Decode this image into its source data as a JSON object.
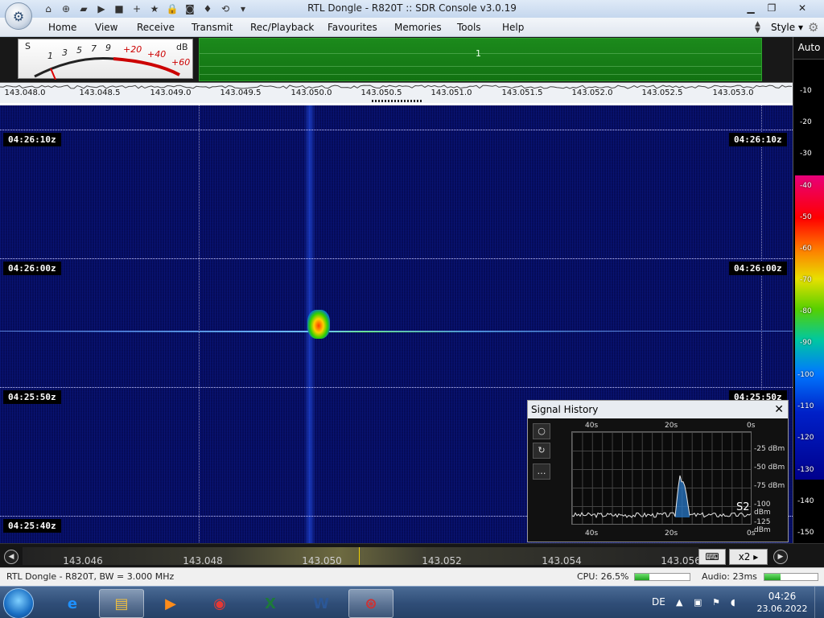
{
  "window": {
    "title": "RTL Dongle - R820T :: SDR Console v3.0.19",
    "min_icon": "minimize-icon",
    "max_icon": "maximize-icon",
    "close_icon": "close-icon"
  },
  "quick_access": [
    {
      "name": "home-icon",
      "glyph": "⌂"
    },
    {
      "name": "lifebuoy-icon",
      "glyph": "⊕"
    },
    {
      "name": "folder-icon",
      "glyph": "▰"
    },
    {
      "name": "play-icon",
      "glyph": "▶"
    },
    {
      "name": "stop-icon",
      "glyph": "■"
    },
    {
      "name": "plus-icon",
      "glyph": "+"
    },
    {
      "name": "star-icon",
      "glyph": "★"
    },
    {
      "name": "lock-icon",
      "glyph": "🔒"
    },
    {
      "name": "camera-icon",
      "glyph": "◙"
    },
    {
      "name": "drop-icon",
      "glyph": "♦"
    },
    {
      "name": "refresh-icon",
      "glyph": "⟲"
    },
    {
      "name": "dropdown-icon",
      "glyph": "▾"
    }
  ],
  "menu": {
    "items": [
      "Home",
      "View",
      "Receive",
      "Transmit",
      "Rec/Playback",
      "Favourites",
      "Memories",
      "Tools",
      "Help"
    ],
    "style_label": "Style"
  },
  "smeter": {
    "s_label": "S",
    "db_label": "dB",
    "scale": [
      "1",
      "3",
      "5",
      "7",
      "9"
    ],
    "over_scale": [
      "+20",
      "+40",
      "+60"
    ]
  },
  "band": {
    "label": "1"
  },
  "freq_scale": {
    "ticks": [
      "143.048.0",
      "143.048.5",
      "143.049.0",
      "143.049.5",
      "143.050.0",
      "143.050.5",
      "143.051.0",
      "143.051.5",
      "143.052.0",
      "143.052.5",
      "143.053.0"
    ]
  },
  "db_column": {
    "auto_label": "Auto",
    "labels": [
      "-10",
      "-20",
      "-30",
      "-40",
      "-50",
      "-60",
      "-70",
      "-80",
      "-90",
      "-100",
      "-110",
      "-120",
      "-130",
      "-140",
      "-150"
    ]
  },
  "waterfall": {
    "times": [
      "04:26:10z",
      "04:26:00z",
      "04:25:50z",
      "04:25:40z"
    ]
  },
  "signal_history": {
    "title": "Signal History",
    "time_labels": [
      "40s",
      "20s",
      "0s"
    ],
    "dbm_labels": [
      "-25 dBm",
      "-50 dBm",
      "-75 dBm",
      "-100 dBm",
      "-125 dBm"
    ],
    "s_value": "S2",
    "buttons": [
      "○",
      "↻",
      "…"
    ]
  },
  "bottom_bar": {
    "freqs": [
      "143.046",
      "143.048",
      "143.050",
      "143.052",
      "143.054",
      "143.056"
    ],
    "zoom_label": "x2"
  },
  "status": {
    "left": "RTL Dongle - R820T, BW = 3.000 MHz",
    "cpu": "CPU: 26.5%",
    "cpu_fraction": 0.265,
    "audio": "Audio: 23ms",
    "audio_fraction": 0.3
  },
  "taskbar": {
    "apps": [
      {
        "name": "internet-explorer-icon",
        "glyph": "e",
        "color": "#1e90ff"
      },
      {
        "name": "file-explorer-icon",
        "glyph": "▤",
        "color": "#f0c040"
      },
      {
        "name": "media-player-icon",
        "glyph": "▶",
        "color": "#ff8c1a"
      },
      {
        "name": "chrome-icon",
        "glyph": "◉",
        "color": "#e53935"
      },
      {
        "name": "excel-icon",
        "glyph": "X",
        "color": "#1d7a3a"
      },
      {
        "name": "word-icon",
        "glyph": "W",
        "color": "#2b5797"
      },
      {
        "name": "sdr-console-icon",
        "glyph": "⊛",
        "color": "#d32f2f"
      }
    ],
    "lang": "DE",
    "time": "04:26",
    "date": "23.06.2022"
  }
}
